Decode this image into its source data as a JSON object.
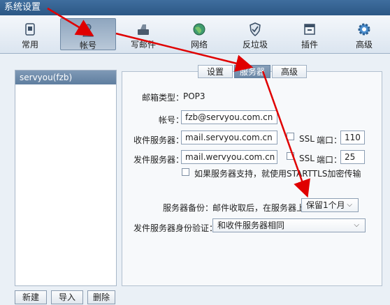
{
  "window": {
    "title": "系统设置"
  },
  "toolbar": {
    "items": [
      {
        "label": "常用",
        "icon": "general-icon"
      },
      {
        "label": "帐号",
        "icon": "account-icon",
        "active": true
      },
      {
        "label": "写邮件",
        "icon": "compose-icon"
      },
      {
        "label": "网络",
        "icon": "network-icon"
      },
      {
        "label": "反垃圾",
        "icon": "antispam-icon"
      },
      {
        "label": "插件",
        "icon": "plugin-icon"
      },
      {
        "label": "高级",
        "icon": "advanced-icon"
      }
    ]
  },
  "accounts": {
    "items": [
      "servyou(fzb)"
    ]
  },
  "account_buttons": {
    "new": "新建",
    "import": "导入",
    "delete": "删除"
  },
  "tabs": {
    "settings": "设置",
    "server": "服务器",
    "advanced": "高级",
    "selected": "服务器"
  },
  "form": {
    "mailbox_type_label": "邮箱类型：",
    "mailbox_type_value": "POP3",
    "account_label": "帐号：",
    "account_value": "fzb@servyou.com.cn",
    "incoming_label": "收件服务器：",
    "incoming_value": "mail.servyou.com.cn",
    "incoming_ssl_label": "SSL",
    "incoming_port_label": "端口：",
    "incoming_port": "110",
    "outgoing_label": "发件服务器：",
    "outgoing_value": "mail.wervyou.com.cn",
    "outgoing_ssl_label": "SSL",
    "outgoing_port_label": "端口：",
    "outgoing_port": "25",
    "starttls_label": "如果服务器支持，就使用STARTTLS加密传输",
    "backup_label": "服务器备份：",
    "backup_desc": "邮件收取后，在服务器上",
    "backup_value": "保留1个月",
    "auth_label": "发件服务器身份验证：",
    "auth_value": "和收件服务器相同"
  },
  "annotation": {
    "arrow_color": "#e00000"
  }
}
